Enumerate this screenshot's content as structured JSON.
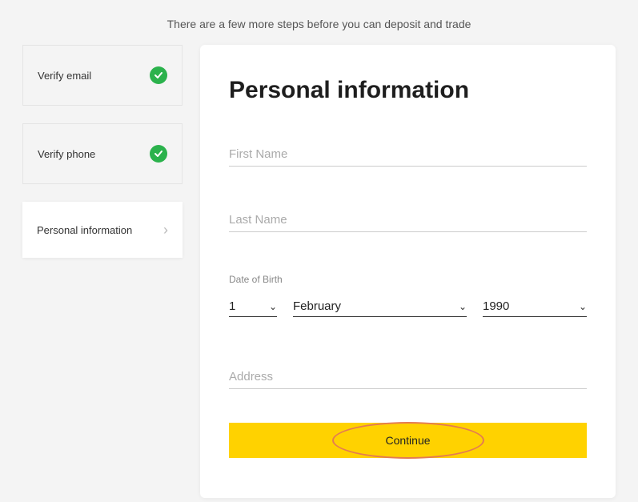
{
  "subtitle": "There are a few more steps before you can deposit and trade",
  "sidebar": {
    "items": [
      {
        "label": "Verify email"
      },
      {
        "label": "Verify phone"
      },
      {
        "label": "Personal information"
      }
    ]
  },
  "card": {
    "title": "Personal information",
    "first_name_placeholder": "First Name",
    "last_name_placeholder": "Last Name",
    "dob_label": "Date of Birth",
    "dob": {
      "day": "1",
      "month": "February",
      "year": "1990"
    },
    "address_placeholder": "Address",
    "continue_label": "Continue"
  }
}
